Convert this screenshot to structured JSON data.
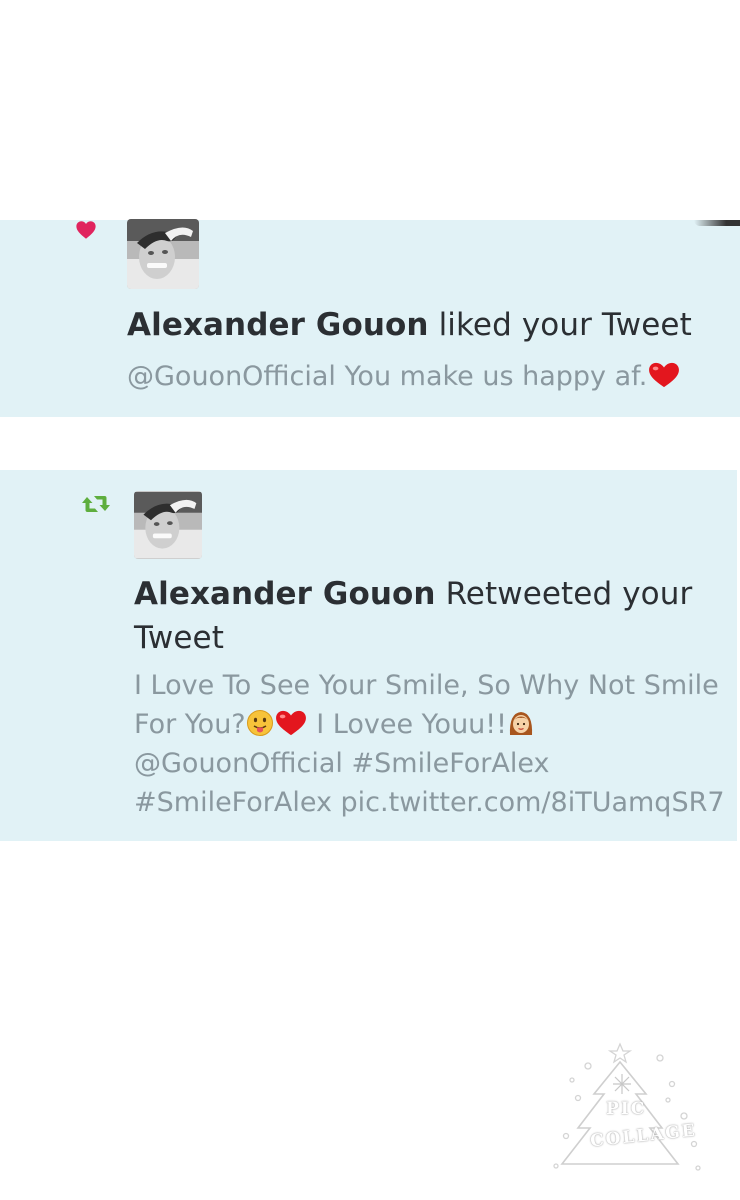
{
  "notifications": [
    {
      "type": "like",
      "icon": "heart-icon",
      "icon_color": "#e0245e",
      "user_name": "Alexander Gouon",
      "action_text": " liked your Tweet",
      "tweet_text": "@GouonOfficial You make us happy af."
    },
    {
      "type": "retweet",
      "icon": "retweet-icon",
      "icon_color": "#5eae3e",
      "user_name": "Alexander Gouon",
      "action_text": " Retweeted your",
      "action_text_2": "Tweet",
      "tweet_lines": [
        "I Love To See Your Smile, So Why Not Smile",
        "For You?",
        " I Lovee Youu!!",
        "@GouonOfficial #SmileForAlex",
        "#SmileForAlex pic.twitter.com/8iTUamqSR7"
      ]
    }
  ],
  "watermark": {
    "line1": "PIC",
    "line2": "COLLAGE"
  },
  "colors": {
    "card_background": "#e1f2f6",
    "name_text": "#2b2f33",
    "tweet_text": "#8a989f"
  }
}
